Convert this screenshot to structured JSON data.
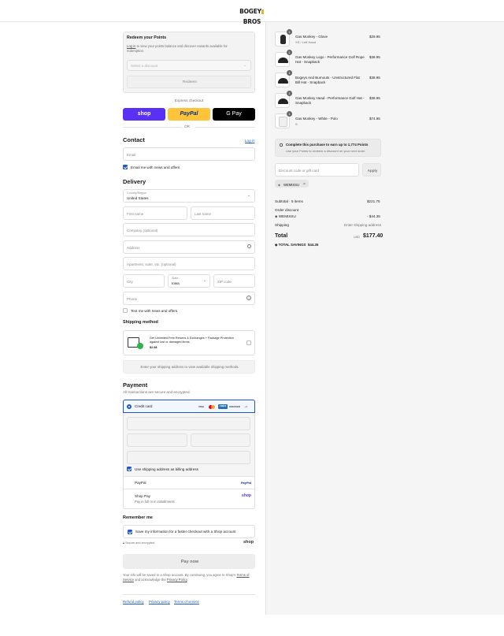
{
  "brand": {
    "logo_text_a": "BOGEY",
    "logo_text_b": "BROS"
  },
  "points": {
    "title": "Redeem your Points",
    "login_link": "Log in",
    "description": "to view your points balance and discover rewards available for redemption.",
    "select_placeholder": "Select a discount",
    "redeem_label": "Redeem"
  },
  "express": {
    "label": "Express checkout",
    "shop_label": "shop",
    "paypal_label": "PayPal",
    "gpay_label": "G Pay",
    "or_label": "OR"
  },
  "contact": {
    "title": "Contact",
    "login_link": "Log in",
    "email_placeholder": "Email",
    "news_label": "Email me with news and offers"
  },
  "delivery": {
    "title": "Delivery",
    "country_label": "Country/Region",
    "country_value": "United States",
    "first_name": "First name",
    "last_name": "Last name",
    "company": "Company (optional)",
    "address": "Address",
    "apartment": "Apartment, suite, etc. (optional)",
    "city": "City",
    "state_label": "State",
    "state_value": "Iowa",
    "zip": "ZIP code",
    "phone": "Phone",
    "text_news": "Text me with news and offers"
  },
  "shipping": {
    "title": "Shipping method",
    "protection_text": "Get Unlimited Free Returns & Exchanges + Package Protection against lost or damaged items",
    "protection_price": "$2.98",
    "notice": "Enter your shipping address to view available shipping methods."
  },
  "payment": {
    "title": "Payment",
    "subtitle": "All transactions are secure and encrypted.",
    "credit_card": "Credit card",
    "card_brands": [
      "VISA",
      "MC",
      "AMEX",
      "DISCOVER",
      "+4"
    ],
    "billing_same": "Use shipping address as billing address",
    "paypal": "PayPal",
    "paypal_logo": "PayPal",
    "shop_pay": "Shop Pay",
    "shop_pay_sub": "Pay in full or in installments",
    "shop_pay_logo": "shop"
  },
  "remember": {
    "title": "Remember me",
    "save_label": "Save my information for a faster checkout with a Shop account",
    "secure": "Secure and encrypted",
    "shop_logo": "shop"
  },
  "pay_now": "Pay now",
  "legal": {
    "text_a": "Your info will be saved to a Shop account. By continuing, you agree to Shop's",
    "terms": "Terms of Service",
    "text_b": "and acknowledge the",
    "privacy": "Privacy Policy",
    "text_c": "."
  },
  "footer": {
    "refund": "Refund policy",
    "privacy": "Privacy policy",
    "terms": "Terms of service"
  },
  "cart": {
    "items": [
      {
        "name": "Gas Monkey - Glove",
        "variant": "XS / Left Hand",
        "price": "$29.95",
        "qty": "1",
        "image": "glove-icon"
      },
      {
        "name": "Gas Monkey Logo - Performance Golf Rope Hat - Snapback",
        "variant": "",
        "price": "$38.95",
        "qty": "1",
        "image": "hat-icon"
      },
      {
        "name": "Bogeys And Burnouts - Unstructured Flat Bill Hat - Snapback",
        "variant": "",
        "price": "$38.95",
        "qty": "1",
        "image": "hat-icon"
      },
      {
        "name": "Gas Monkey Head - Performance Golf Hat - Snapback",
        "variant": "",
        "price": "$38.95",
        "qty": "1",
        "image": "hat-icon"
      },
      {
        "name": "Gas Monkey - White - Polo",
        "variant": "S",
        "price": "$74.95",
        "qty": "1",
        "image": "polo-icon"
      }
    ],
    "points_title": "Complete this purchase to earn up to 1,774 Points",
    "points_sub": "Use your Points to redeem a discount on your next order.",
    "discount_placeholder": "Discount code or gift card",
    "apply": "Apply",
    "applied_code": "WEMISSU"
  },
  "summary": {
    "subtotal_label": "Subtotal · 5 items",
    "subtotal": "$221.75",
    "order_discount_label": "Order discount",
    "discount_code": "WEMISSU",
    "discount_value": "- $44.35",
    "shipping_label": "Shipping",
    "shipping_value": "Enter shipping address",
    "total_label": "Total",
    "currency": "USD",
    "total": "$177.40",
    "savings_label": "TOTAL SAVINGS",
    "savings": "$44.35"
  },
  "colors": {
    "accent": "#1f56c9",
    "shop": "#5a31f4",
    "paypal": "#ffc439"
  }
}
